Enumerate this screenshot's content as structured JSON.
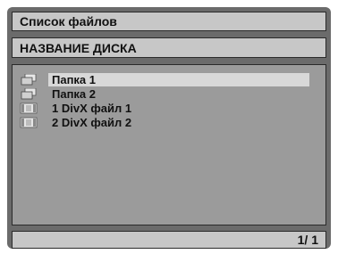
{
  "header": {
    "title": "Список файлов"
  },
  "disc": {
    "name": "НАЗВАНИЕ ДИСКА"
  },
  "files": [
    {
      "label": "Папка 1",
      "type": "folder",
      "icon": "folder-icon",
      "selected": true
    },
    {
      "label": "Папка 2",
      "type": "folder",
      "icon": "folder-icon",
      "selected": false
    },
    {
      "label": "1 DivX файл 1",
      "type": "video",
      "icon": "video-file-icon",
      "selected": false
    },
    {
      "label": "2 DivX файл 2",
      "type": "video",
      "icon": "video-file-icon",
      "selected": false
    }
  ],
  "status": {
    "page": "1/ 1"
  },
  "colors": {
    "frame": "#6b6b6b",
    "bar": "#c7c7c7",
    "list": "#9b9b9b",
    "selected": "#d8d8d8"
  }
}
